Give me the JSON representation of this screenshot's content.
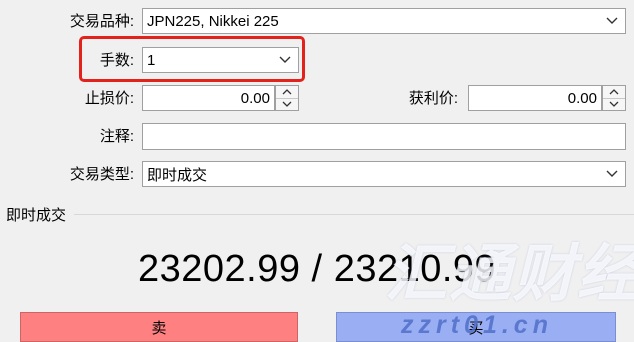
{
  "form": {
    "symbol": {
      "label": "交易品种:",
      "value": "JPN225, Nikkei 225"
    },
    "volume": {
      "label": "手数:",
      "value": "1"
    },
    "stop_loss": {
      "label": "止损价:",
      "value": "0.00"
    },
    "take_profit": {
      "label": "获利价:",
      "value": "0.00"
    },
    "comment": {
      "label": "注释:",
      "value": ""
    },
    "order_type": {
      "label": "交易类型:",
      "value": "即时成交"
    }
  },
  "section": {
    "title": "即时成交"
  },
  "quote": {
    "bid": "23202.99",
    "separator": " / ",
    "ask": "23210.99"
  },
  "buttons": {
    "sell": "卖",
    "buy": "买"
  },
  "watermark": {
    "name": "汇通财经",
    "url": "zzrt01.cn"
  },
  "colors": {
    "highlight": "#e3221b",
    "sell": "#ff8080",
    "buy": "#9aaef4"
  }
}
